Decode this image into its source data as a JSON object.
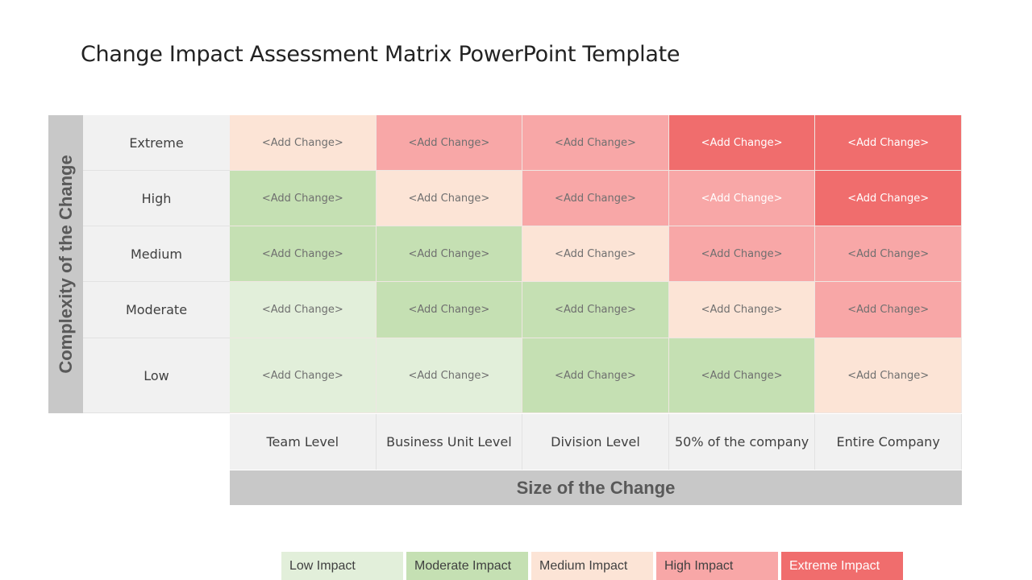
{
  "title": "Change Impact Assessment Matrix PowerPoint Template",
  "y_axis_label": "Complexity of the Change",
  "x_axis_label": "Size of the Change",
  "colors": {
    "low": "#e2efda",
    "moderate": "#c5e0b3",
    "medium": "#fce4d6",
    "high": "#f8a7a7",
    "extreme": "#f06d6d"
  },
  "rows": [
    {
      "label": "Extreme",
      "cells": [
        {
          "text": "<Add Change>",
          "level": "medium"
        },
        {
          "text": "<Add Change>",
          "level": "high"
        },
        {
          "text": "<Add Change>",
          "level": "high"
        },
        {
          "text": "<Add Change>",
          "level": "extreme"
        },
        {
          "text": "<Add Change>",
          "level": "extreme"
        }
      ]
    },
    {
      "label": "High",
      "cells": [
        {
          "text": "<Add Change>",
          "level": "moderate"
        },
        {
          "text": "<Add Change>",
          "level": "medium"
        },
        {
          "text": "<Add Change>",
          "level": "high"
        },
        {
          "text": "<Add Change>",
          "level": "high"
        },
        {
          "text": "<Add Change>",
          "level": "extreme"
        }
      ]
    },
    {
      "label": "Medium",
      "cells": [
        {
          "text": "<Add Change>",
          "level": "moderate"
        },
        {
          "text": "<Add Change>",
          "level": "moderate"
        },
        {
          "text": "<Add Change>",
          "level": "medium"
        },
        {
          "text": "<Add Change>",
          "level": "high"
        },
        {
          "text": "<Add Change>",
          "level": "high"
        }
      ]
    },
    {
      "label": "Moderate",
      "cells": [
        {
          "text": "<Add Change>",
          "level": "low"
        },
        {
          "text": "<Add Change>",
          "level": "moderate"
        },
        {
          "text": "<Add Change>",
          "level": "moderate"
        },
        {
          "text": "<Add Change>",
          "level": "medium"
        },
        {
          "text": "<Add Change>",
          "level": "high"
        }
      ]
    },
    {
      "label": "Low",
      "cells": [
        {
          "text": "<Add Change>",
          "level": "low"
        },
        {
          "text": "<Add Change>",
          "level": "low"
        },
        {
          "text": "<Add Change>",
          "level": "moderate"
        },
        {
          "text": "<Add Change>",
          "level": "moderate"
        },
        {
          "text": "<Add Change>",
          "level": "medium"
        }
      ]
    }
  ],
  "columns": [
    "Team Level",
    "Business Unit Level",
    "Division Level",
    "50% of the company",
    "Entire Company"
  ],
  "legend": [
    {
      "label": "Low Impact",
      "level": "low"
    },
    {
      "label": "Moderate Impact",
      "level": "moderate"
    },
    {
      "label": "Medium Impact",
      "level": "medium"
    },
    {
      "label": "High Impact",
      "level": "high"
    },
    {
      "label": "Extreme Impact",
      "level": "extreme"
    }
  ]
}
